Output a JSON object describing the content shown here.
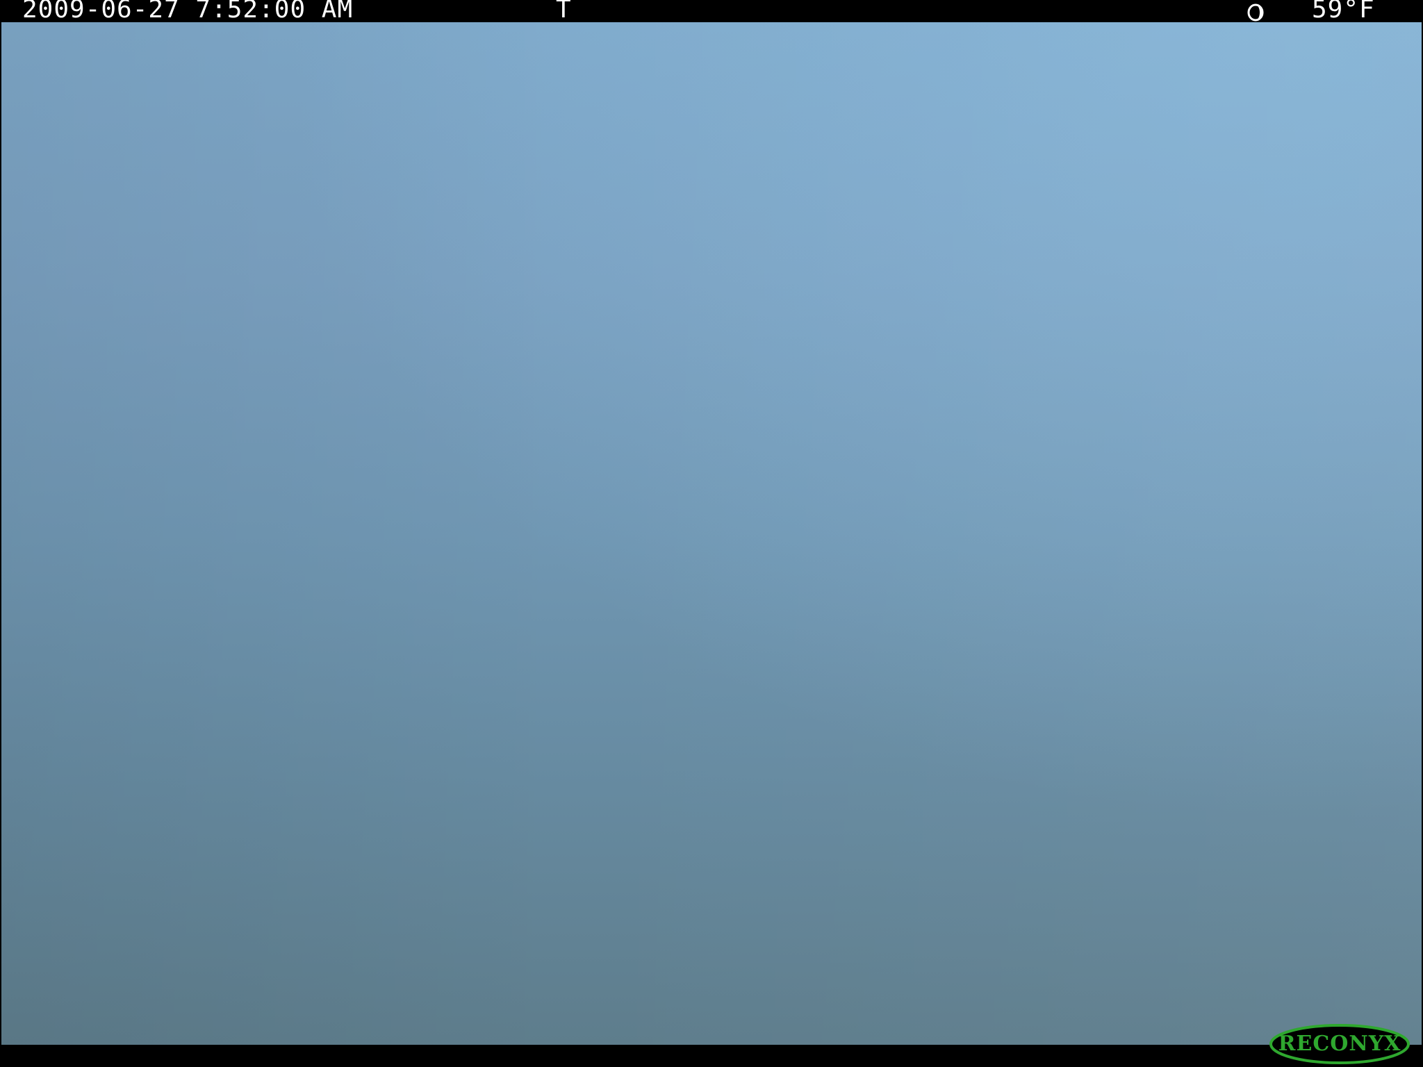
{
  "overlay": {
    "timestamp": "2009-06-27 7:52:00 AM",
    "trigger": "T",
    "moon_phase_icon": "moon-phase-icon",
    "temperature": "59°F"
  },
  "logo": {
    "text": "RECONYX",
    "color": "#2fa82f"
  },
  "scene": {
    "sky_color_top": "#7ea8c9",
    "sky_color_bottom": "#5e7d8c"
  }
}
